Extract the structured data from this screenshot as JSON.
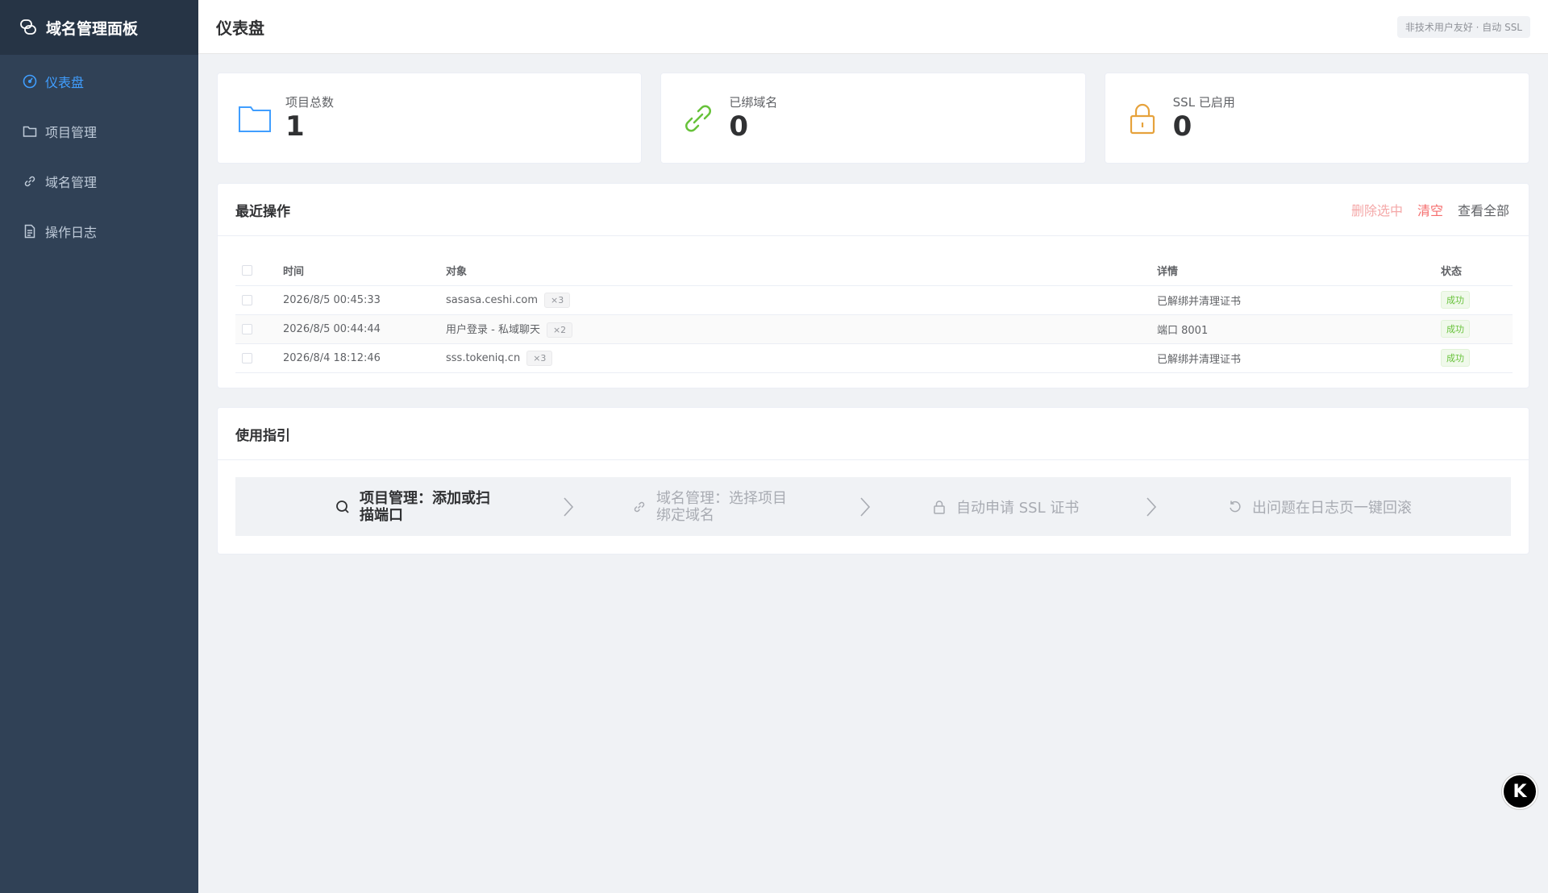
{
  "app": {
    "title": "域名管理面板"
  },
  "sidebar": {
    "items": [
      {
        "label": "仪表盘",
        "icon": "dashboard-icon",
        "active": true
      },
      {
        "label": "项目管理",
        "icon": "folder-icon",
        "active": false
      },
      {
        "label": "域名管理",
        "icon": "link-icon",
        "active": false
      },
      {
        "label": "操作日志",
        "icon": "document-icon",
        "active": false
      }
    ]
  },
  "header": {
    "title": "仪表盘",
    "tag": "非技术用户友好 · 自动 SSL"
  },
  "stats": [
    {
      "label": "项目总数",
      "value": "1",
      "icon": "folder-icon",
      "color": "#409eff"
    },
    {
      "label": "已绑域名",
      "value": "0",
      "icon": "link-icon",
      "color": "#67c23a"
    },
    {
      "label": "SSL 已启用",
      "value": "0",
      "icon": "lock-icon",
      "color": "#e6a23c"
    }
  ],
  "recent": {
    "title": "最近操作",
    "actions": {
      "delete_selected": "删除选中",
      "clear": "清空",
      "view_all": "查看全部"
    },
    "columns": {
      "time": "时间",
      "target": "对象",
      "detail": "详情",
      "status": "状态"
    },
    "rows": [
      {
        "time": "2026/8/5 00:45:33",
        "target": "sasasa.ceshi.com",
        "count": "×3",
        "detail": "已解绑并清理证书",
        "status": "成功"
      },
      {
        "time": "2026/8/5 00:44:44",
        "target": "用户登录 - 私域聊天",
        "count": "×2",
        "detail": "端口 8001",
        "status": "成功"
      },
      {
        "time": "2026/8/4 18:12:46",
        "target": "sss.tokeniq.cn",
        "count": "×3",
        "detail": "已解绑并清理证书",
        "status": "成功"
      }
    ]
  },
  "guide": {
    "title": "使用指引",
    "steps": [
      {
        "line1": "项目管理：添加或扫",
        "line2": "描端口",
        "icon": "search-icon"
      },
      {
        "line1": "域名管理：选择项目",
        "line2": "绑定域名",
        "icon": "link-icon"
      },
      {
        "line1": "自动申请 SSL 证书",
        "line2": "",
        "icon": "lock-icon"
      },
      {
        "line1": "出问题在日志页一键回滚",
        "line2": "",
        "icon": "undo-icon"
      }
    ]
  },
  "fab": {
    "label": "K"
  },
  "colors": {
    "sidebar": "#304156",
    "brand": "#263445",
    "accent": "#409eff",
    "danger": "#f56c6c",
    "success": "#67c23a",
    "warning": "#e6a23c"
  }
}
